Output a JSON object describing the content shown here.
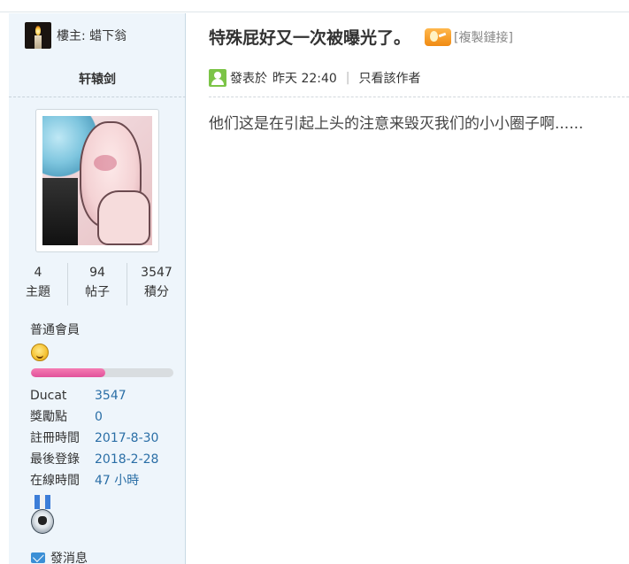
{
  "thread": {
    "owner_label": "樓主: 蜡下翁",
    "title": "特殊屁好又一次被曝光了。",
    "copy_link": "[複製鏈接]",
    "hot_icon": "hot-badge-icon"
  },
  "user": {
    "username": "轩辕剑",
    "stats": [
      {
        "value": "4",
        "label": "主題"
      },
      {
        "value": "94",
        "label": "帖子"
      },
      {
        "value": "3547",
        "label": "積分"
      }
    ],
    "group": "普通會員",
    "level_progress": 0.52,
    "info": [
      {
        "key": "Ducat",
        "value": "3547"
      },
      {
        "key": "獎勵點",
        "value": "0"
      },
      {
        "key": "註冊時間",
        "value": "2017-8-30"
      },
      {
        "key": "最後登錄",
        "value": "2018-2-28"
      },
      {
        "key": "在線時間",
        "value": "47 小時"
      }
    ],
    "send_message": "發消息"
  },
  "post": {
    "posted_label": "發表於",
    "posted_time": "昨天 22:40",
    "separator": "|",
    "author_only": "只看該作者",
    "body": "他们这是在引起上头的注意来毁灭我们的小小圈子啊......"
  },
  "colors": {
    "sidebar_bg": "#eef5fb",
    "link_blue": "#2a6ea6",
    "progress_pink": "#e2529a",
    "poster_green": "#7cc447"
  }
}
